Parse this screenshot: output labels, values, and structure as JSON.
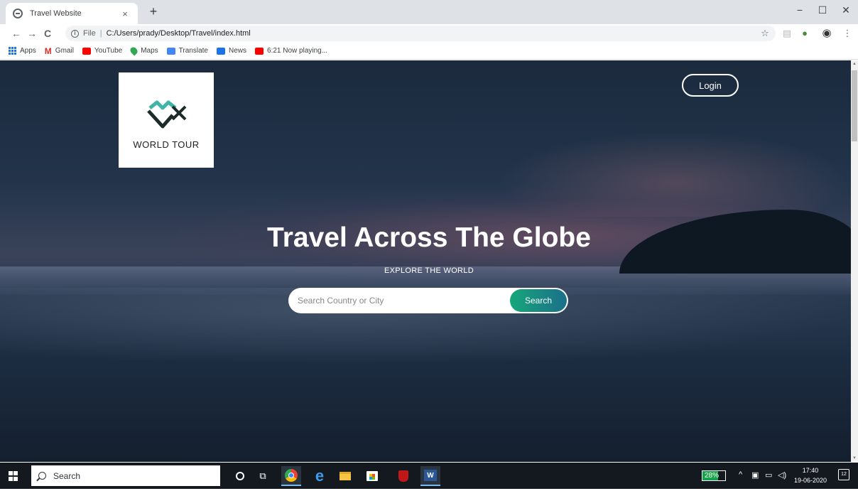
{
  "browser": {
    "tab": {
      "title": "Travel Website",
      "close": "×"
    },
    "new_tab": "+",
    "window_controls": {
      "minimize": "−",
      "maximize": "☐",
      "close": "✕"
    },
    "nav": {
      "back": "←",
      "forward": "→",
      "reload": "C"
    },
    "address": {
      "scheme": "File",
      "separator": "|",
      "url": "C:/Users/prady/Desktop/Travel/index.html"
    },
    "toolbar_icons": [
      "star-icon",
      "extension-icon",
      "earth-icon",
      "profile-icon",
      "menu-icon"
    ],
    "bookmarks": [
      {
        "label": "Apps",
        "icon": "apps-grid-icon"
      },
      {
        "label": "Gmail",
        "icon": "gmail-icon"
      },
      {
        "label": "YouTube",
        "icon": "youtube-icon"
      },
      {
        "label": "Maps",
        "icon": "maps-icon"
      },
      {
        "label": "Translate",
        "icon": "translate-icon"
      },
      {
        "label": "News",
        "icon": "news-icon"
      },
      {
        "label": "6:21 Now playing...",
        "icon": "youtube-icon"
      }
    ]
  },
  "page": {
    "logo_text": "WORLD TOUR",
    "login_label": "Login",
    "hero_title": "Travel Across The Globe",
    "hero_subtitle": "EXPLORE THE WORLD",
    "search_placeholder": "Search Country or City",
    "search_button": "Search",
    "colors": {
      "search_gradient_start": "#16a77a",
      "search_gradient_end": "#1b6f8a",
      "logo_teal": "#3fb5a8"
    }
  },
  "taskbar": {
    "search_text": "Search",
    "apps": [
      "cortana-icon",
      "task-view-icon",
      "chrome-icon",
      "edge-icon",
      "file-explorer-icon",
      "store-icon",
      "mcafee-icon",
      "word-icon"
    ],
    "battery": "28%",
    "battery_level": 0.28,
    "time": "17:40",
    "date": "19-06-2020",
    "notifications": "12"
  }
}
